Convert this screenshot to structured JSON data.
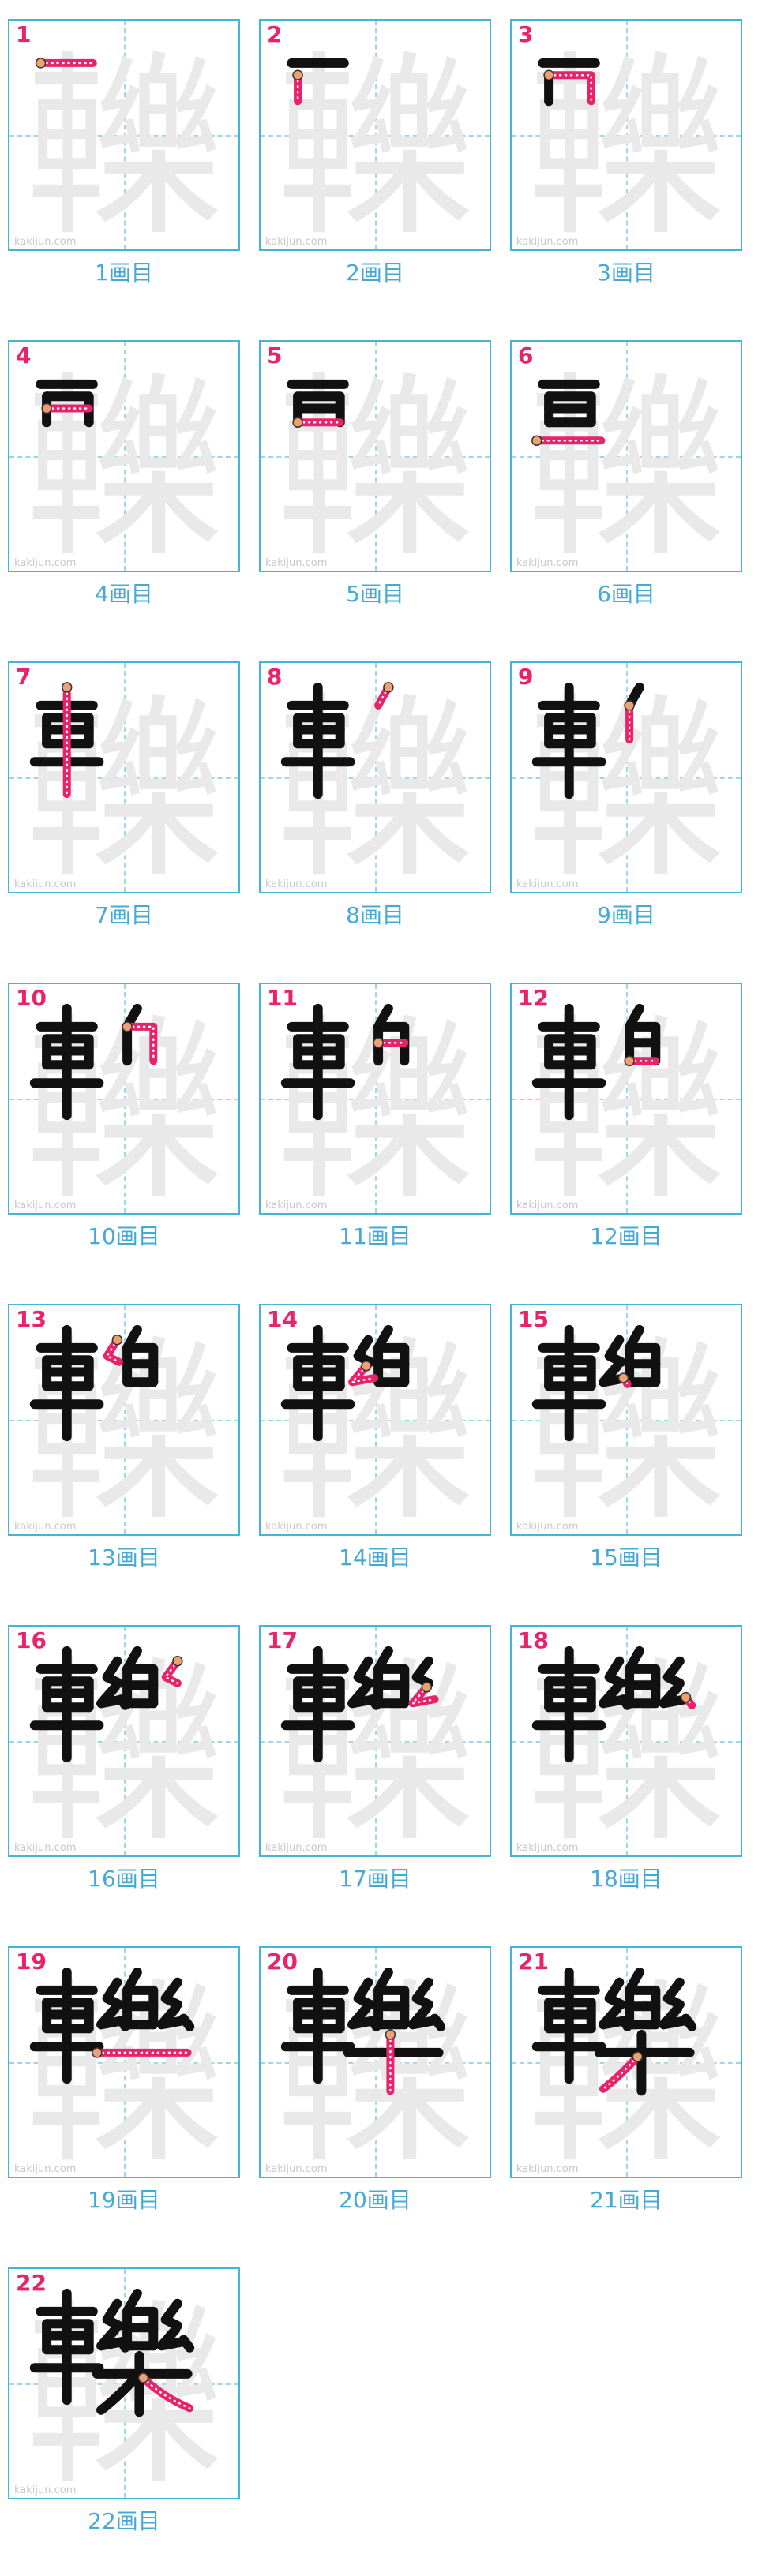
{
  "character": "轢",
  "watermark": "kakijun.com",
  "colors": {
    "border": "#45b5d6",
    "guide": "#9fd6e8",
    "number": "#e8236b",
    "caption": "#45a9d6",
    "ghost": "#e9e9e9",
    "ink": "#111111",
    "current_stroke": "#e8236b",
    "start_dot": "#f0a070"
  },
  "cells": [
    {
      "number": "1",
      "caption": "1画目"
    },
    {
      "number": "2",
      "caption": "2画目"
    },
    {
      "number": "3",
      "caption": "3画目"
    },
    {
      "number": "4",
      "caption": "4画目"
    },
    {
      "number": "5",
      "caption": "5画目"
    },
    {
      "number": "6",
      "caption": "6画目"
    },
    {
      "number": "7",
      "caption": "7画目"
    },
    {
      "number": "8",
      "caption": "8画目"
    },
    {
      "number": "9",
      "caption": "9画目"
    },
    {
      "number": "10",
      "caption": "10画目"
    },
    {
      "number": "11",
      "caption": "11画目"
    },
    {
      "number": "12",
      "caption": "12画目"
    },
    {
      "number": "13",
      "caption": "13画目"
    },
    {
      "number": "14",
      "caption": "14画目"
    },
    {
      "number": "15",
      "caption": "15画目"
    },
    {
      "number": "16",
      "caption": "16画目"
    },
    {
      "number": "17",
      "caption": "17画目"
    },
    {
      "number": "18",
      "caption": "18画目"
    },
    {
      "number": "19",
      "caption": "19画目"
    },
    {
      "number": "20",
      "caption": "20画目"
    },
    {
      "number": "21",
      "caption": "21画目"
    },
    {
      "number": "22",
      "caption": "22画目"
    }
  ]
}
